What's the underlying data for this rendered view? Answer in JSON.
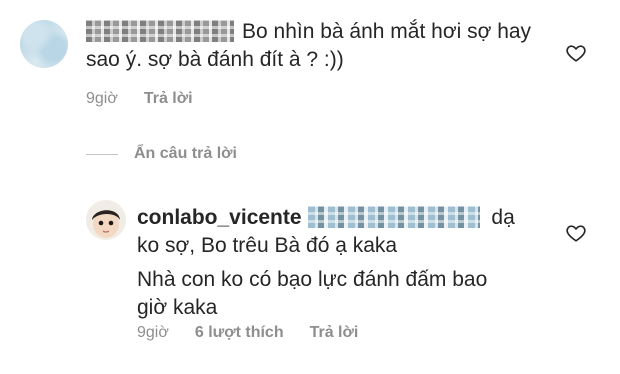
{
  "comment1": {
    "text": "Bo nhìn bà ánh mắt hơi sợ hay sao ý. sợ bà đánh đít à ? :))",
    "time": "9giờ",
    "reply_label": "Trả lời",
    "icon": "heart-outline"
  },
  "hide_replies_label": "Ẩn câu trả lời",
  "comment2": {
    "username": "conlabo_vicente",
    "line1_end": " dạ",
    "line2": "ko sợ, Bo trêu Bà đó ạ kaka",
    "line3": "Nhà con ko có bạo lực đánh đấm bao",
    "line4": "giờ kaka",
    "time": "9giờ",
    "likes": "6 lượt thích",
    "reply_label": "Trả lời",
    "icon": "heart-outline"
  }
}
